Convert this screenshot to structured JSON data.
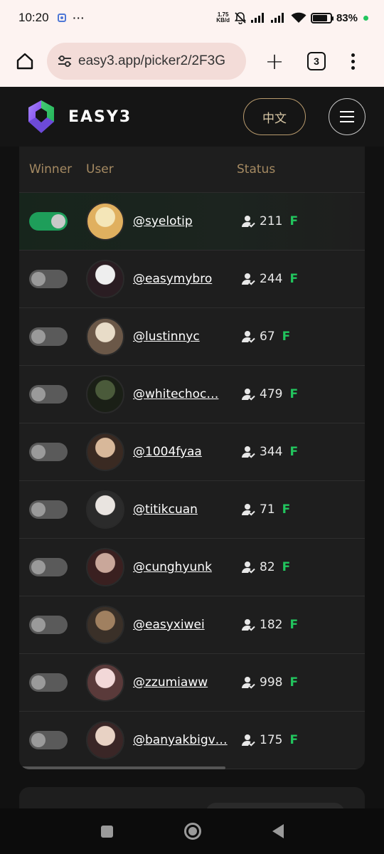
{
  "status_bar": {
    "time": "10:20",
    "more": "···",
    "net_speed_value": "1.75",
    "net_speed_unit": "KB/d",
    "battery_percent": "83%",
    "battery_level": 0.83
  },
  "browser": {
    "url": "easy3.app/picker2/2F3G",
    "new_tab": "+",
    "tab_count": "3"
  },
  "header": {
    "brand": "EASY3",
    "lang_button": "中文",
    "colors": {
      "accent_gold": "#b89a6d",
      "logo_purple": "#8b5cf6",
      "logo_green": "#22c55e"
    }
  },
  "table": {
    "columns": {
      "winner": "Winner",
      "user": "User",
      "status": "Status"
    },
    "rows": [
      {
        "winner": true,
        "username": "@syelotip",
        "followers": "211",
        "flag": "F"
      },
      {
        "winner": false,
        "username": "@easymybro",
        "followers": "244",
        "flag": "F"
      },
      {
        "winner": false,
        "username": "@lustinnyc",
        "followers": "67",
        "flag": "F"
      },
      {
        "winner": false,
        "username": "@whitechoc…",
        "followers": "479",
        "flag": "F"
      },
      {
        "winner": false,
        "username": "@1004fyaa",
        "followers": "344",
        "flag": "F"
      },
      {
        "winner": false,
        "username": "@titikcuan",
        "followers": "71",
        "flag": "F"
      },
      {
        "winner": false,
        "username": "@cunghyunk",
        "followers": "82",
        "flag": "F"
      },
      {
        "winner": false,
        "username": "@easyxiwei",
        "followers": "182",
        "flag": "F"
      },
      {
        "winner": false,
        "username": "@zzumiaww",
        "followers": "998",
        "flag": "F"
      },
      {
        "winner": false,
        "username": "@banyakbigv…",
        "followers": "175",
        "flag": "F"
      }
    ],
    "toggle_on_color": "#1e9e5a",
    "flag_color": "#22c55e"
  }
}
